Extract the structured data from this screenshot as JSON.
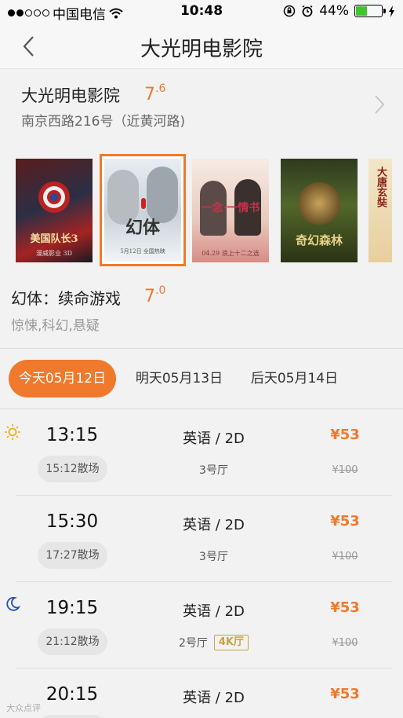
{
  "status_bar": {
    "carrier": "中国电信",
    "time": "10:48",
    "battery": "44%",
    "battery_level": 0.44
  },
  "nav": {
    "title": "大光明电影院"
  },
  "cinema": {
    "name": "大光明电影院",
    "rating_int": "7",
    "rating_dec": ".6",
    "address": "南京西路216号（近黄河路)"
  },
  "posters": [
    {
      "text_main": "美国队长3",
      "text_sub": "漫威影业 3D"
    },
    {
      "text_main": "幻体",
      "text_sub": "5月12日 全国热映"
    },
    {
      "text_main": "一念·一情书",
      "text_sub": "04.29 浪上十二之选"
    },
    {
      "text_main": "奇幻森林",
      "text_sub": ""
    },
    {
      "text_main": "大唐玄奘",
      "text_sub": ""
    }
  ],
  "movie": {
    "title": "幻体：续命游戏",
    "rating_int": "7",
    "rating_dec": ".0",
    "tags": "惊悚,科幻,悬疑"
  },
  "dates": [
    {
      "label": "今天05月12日",
      "active": true
    },
    {
      "label": "明天05月13日",
      "active": false
    },
    {
      "label": "后天05月14日",
      "active": false
    }
  ],
  "shows": [
    {
      "start": "13:15",
      "end": "15:12散场",
      "lang": "英语 / 2D",
      "hall": "3号厅",
      "badge": "",
      "price": "¥53",
      "original": "¥100"
    },
    {
      "start": "15:30",
      "end": "17:27散场",
      "lang": "英语 / 2D",
      "hall": "3号厅",
      "badge": "",
      "price": "¥53",
      "original": "¥100"
    },
    {
      "start": "19:15",
      "end": "21:12散场",
      "lang": "英语 / 2D",
      "hall": "2号厅",
      "badge": "4K厅",
      "price": "¥53",
      "original": "¥100"
    },
    {
      "start": "20:15",
      "end": "",
      "lang": "英语 / 2D",
      "hall": "",
      "badge": "",
      "price": "¥53",
      "original": ""
    }
  ],
  "icons": {
    "morning": "sun-icon",
    "evening": "moon-icon"
  },
  "colors": {
    "accent": "#f0792b",
    "badge_4k": "#caa13e"
  },
  "watermark": "大众点评"
}
